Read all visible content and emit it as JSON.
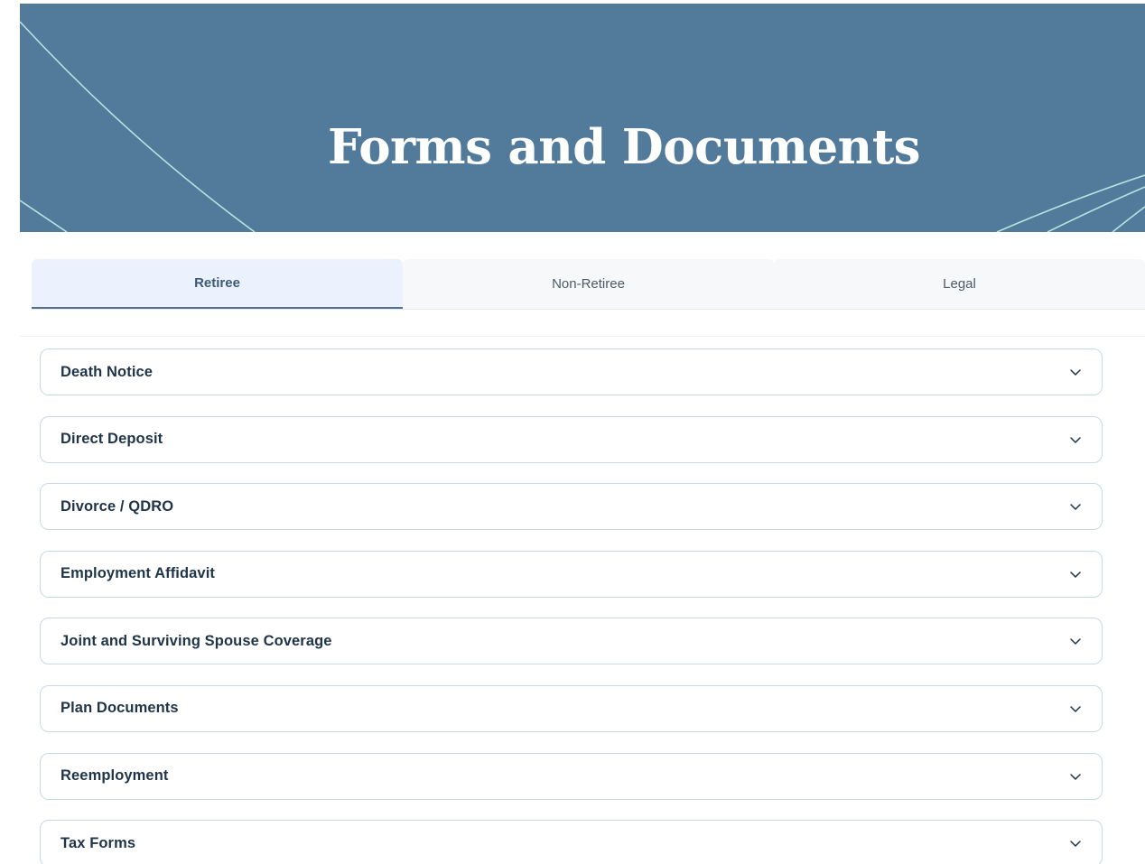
{
  "hero": {
    "title": "Forms and Documents",
    "background_color": "#527b9b",
    "line_color": "#b7e3e1"
  },
  "tabs": [
    {
      "label": "Retiree",
      "active": true
    },
    {
      "label": "Non-Retiree",
      "active": false
    },
    {
      "label": "Legal",
      "active": false
    }
  ],
  "accordion": {
    "items": [
      {
        "label": "Death Notice",
        "icon": "chevron-down-icon"
      },
      {
        "label": "Direct Deposit",
        "icon": "chevron-down-icon"
      },
      {
        "label": "Divorce / QDRO",
        "icon": "chevron-down-icon"
      },
      {
        "label": "Employment Affidavit",
        "icon": "chevron-down-icon"
      },
      {
        "label": "Joint and Surviving Spouse Coverage",
        "icon": "chevron-down-icon"
      },
      {
        "label": "Plan Documents",
        "icon": "chevron-down-icon"
      },
      {
        "label": "Reemployment",
        "icon": "chevron-down-icon"
      },
      {
        "label": "Tax Forms",
        "icon": "chevron-down-icon"
      }
    ]
  }
}
